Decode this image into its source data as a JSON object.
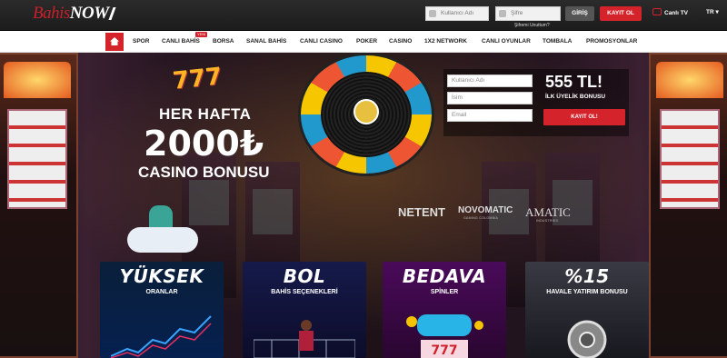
{
  "header": {
    "logo_text_1": "Bahis",
    "logo_text_2": "NOW",
    "username_placeholder": "Kullanıcı Adı",
    "password_placeholder": "Şifre",
    "forgot_password": "Şifremi Unuttum?",
    "login_label": "GİRİŞ",
    "register_label": "KAYIT OL",
    "tv_label": "Canlı TV",
    "lang_label": "TR",
    "accent": "#d4232b"
  },
  "nav": {
    "new_badge": "YENİ",
    "items": [
      "SPOR",
      "CANLI BAHİS",
      "BORSA",
      "SANAL BAHİS",
      "CANLI CASINO",
      "POKER",
      "CASINO",
      "1X2 NETWORK",
      "CANLI OYUNLAR",
      "TOMBALA",
      "PROMOSYONLAR"
    ]
  },
  "hero": {
    "promo_777": "777",
    "promo_line1": "HER HAFTA",
    "promo_line2": "2000₺",
    "promo_line3": "CASINO BONUSU",
    "register": {
      "username_placeholder": "Kullanıcı Adı",
      "name_placeholder": "İsim",
      "email_placeholder": "Email",
      "bonus_amount": "555 TL!",
      "bonus_label": "İLK ÜYELİK BONUSU",
      "button_label": "KAYIT OL!"
    },
    "providers": {
      "netent": "NETENT",
      "novomatic": "NOVOMATIC",
      "novomatic_sub": "GAMING COLOMBIA",
      "amatic": "AMATIC",
      "amatic_sub": "INDUSTRIES"
    }
  },
  "cards": [
    {
      "title": "YÜKSEK",
      "subtitle": "ORANLAR"
    },
    {
      "title": "BOL",
      "subtitle": "BAHİS SEÇENEKLERİ"
    },
    {
      "title": "BEDAVA",
      "subtitle": "SPİNLER"
    },
    {
      "title": "%15",
      "subtitle": "HAVALE YATIRIM BONUSU"
    }
  ]
}
